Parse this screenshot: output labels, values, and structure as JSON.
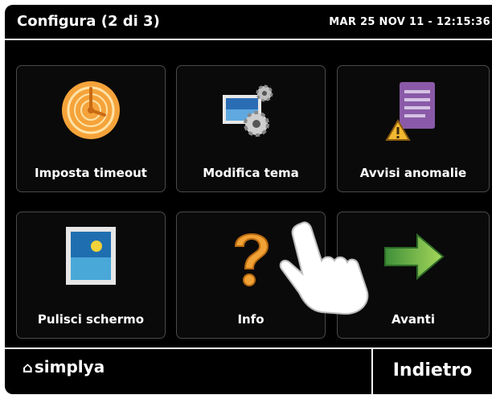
{
  "header": {
    "title": "Configura (2 di 3)",
    "datetime": "MAR 25 NOV 11 - 12:15:36"
  },
  "tiles": [
    {
      "label": "Imposta timeout",
      "icon": "clock-icon"
    },
    {
      "label": "Modifica tema",
      "icon": "theme-gears-icon"
    },
    {
      "label": "Avvisi anomalie",
      "icon": "warning-document-icon"
    },
    {
      "label": "Pulisci schermo",
      "icon": "picture-frame-icon"
    },
    {
      "label": "Info",
      "icon": "question-mark-icon"
    },
    {
      "label": "Avanti",
      "icon": "arrow-right-icon"
    }
  ],
  "footer": {
    "logo_text": "simplya",
    "back_label": "Indietro"
  },
  "colors": {
    "background": "#000000",
    "text": "#ffffff",
    "accent_orange": "#f29a2e",
    "accent_green": "#5bb84a",
    "accent_purple": "#8a5aa8"
  }
}
